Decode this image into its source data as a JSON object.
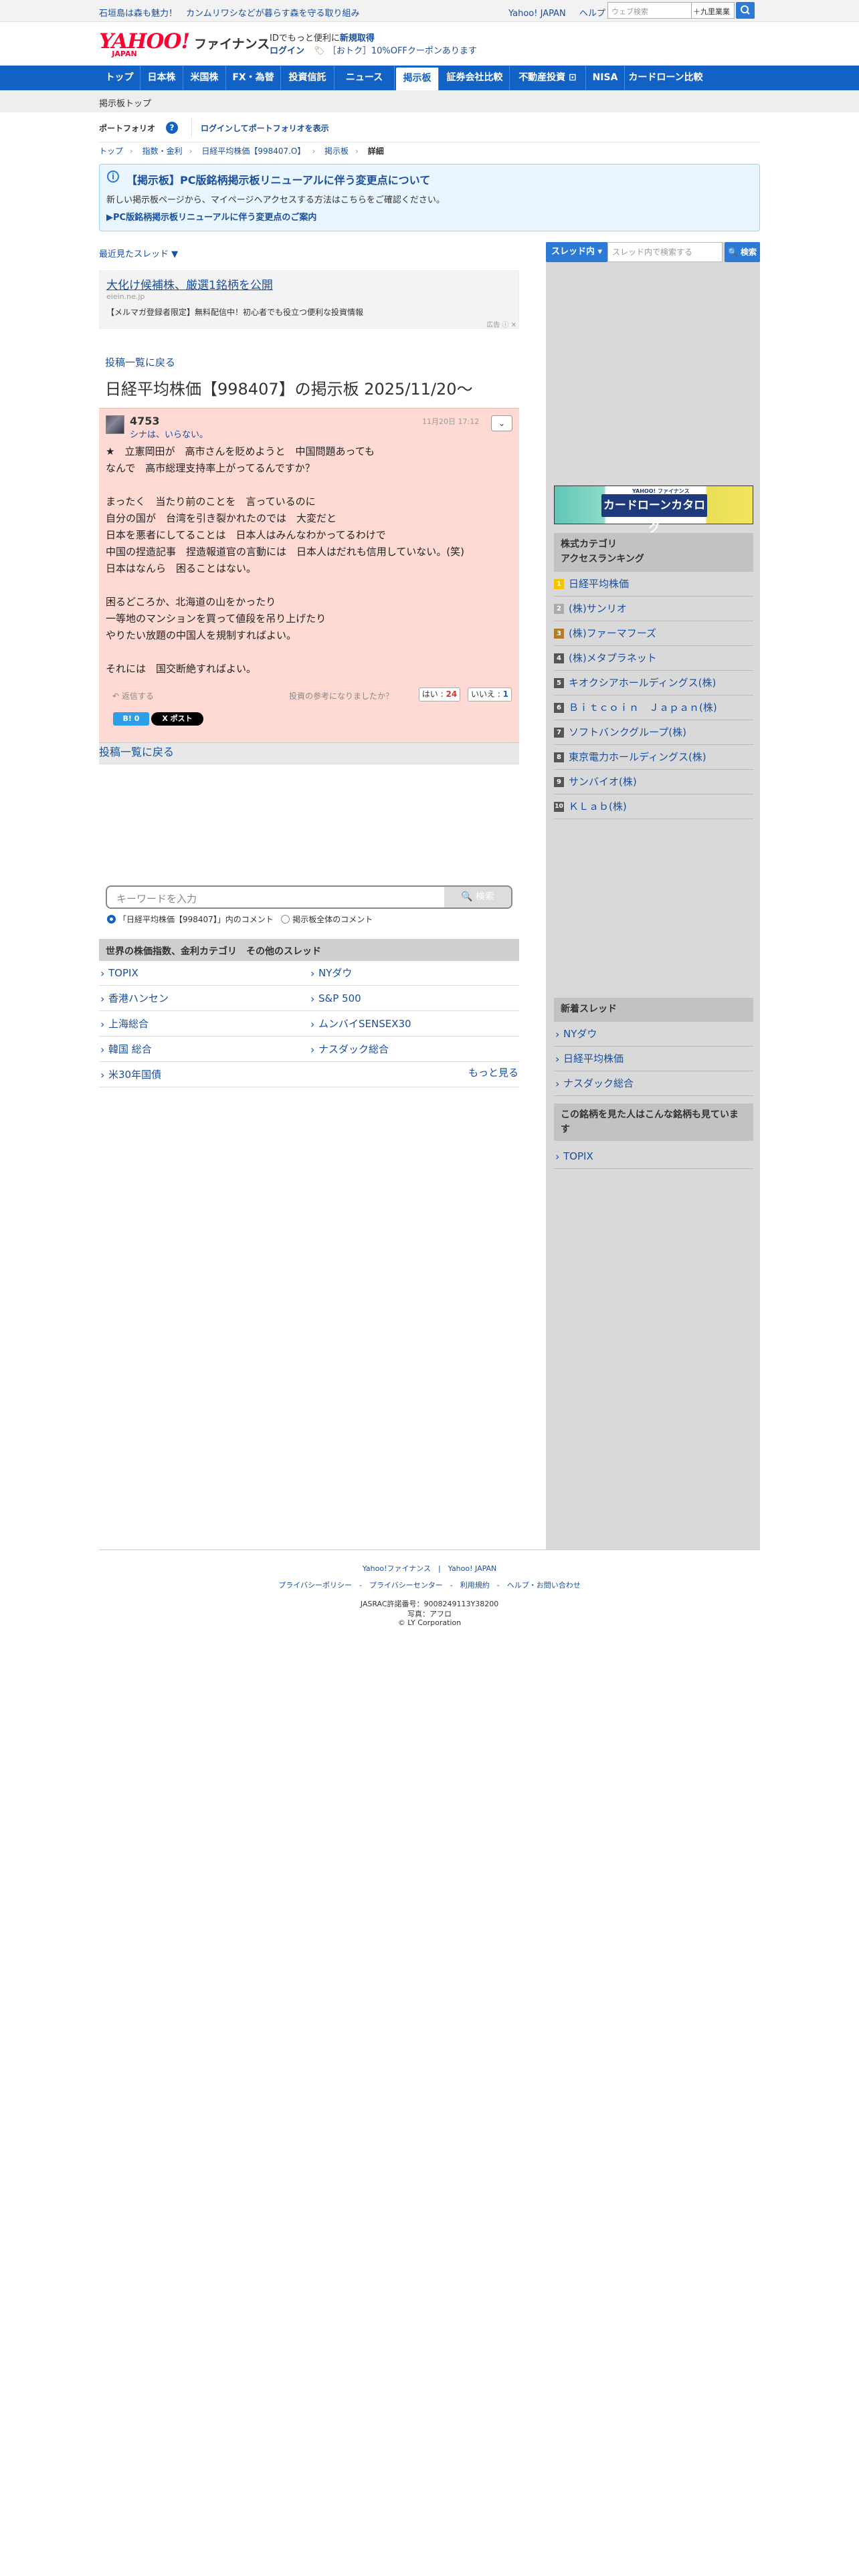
{
  "topbar": {
    "promo": "石垣島は森も魅力！　カンムリワシなどが暮らす森を守る取り組み",
    "links": [
      "Yahoo! JAPAN",
      "ヘルプ"
    ],
    "web_search_placeholder": "ウェブ検索",
    "kudamon_label": "＋九里業業"
  },
  "header": {
    "logo_y": "YAHOO!",
    "logo_j": "JAPAN",
    "logo_f": "ファイナンス",
    "line1_text": "IDでもっと便利に",
    "line1_link": "新規取得",
    "login": "ログイン",
    "coupon": "［おトク］10%OFFクーポンあります"
  },
  "nav": {
    "items": [
      "トップ",
      "日本株",
      "米国株",
      "FX・為替",
      "投資信託",
      "ニュース",
      "掲示板",
      "証券会社比較",
      "不動産投資 ⊡",
      "NISA",
      "カードローン比較"
    ],
    "active_index": 6
  },
  "subnav": {
    "label": "掲示板トップ"
  },
  "portfolio": {
    "title": "ポートフォリオ",
    "help": "?",
    "link": "ログインしてポートフォリオを表示"
  },
  "breadcrumb": [
    "トップ",
    "指数・金利",
    "日経平均株価【998407.O】",
    "掲示板",
    "詳細"
  ],
  "notice": {
    "icon": "i",
    "title": "【掲示板】PC版銘柄掲示板リニューアルに伴う変更点について",
    "desc": "新しい掲示板ページから、マイページへアクセスする方法はこちらをご確認ください。",
    "link": "▶PC版銘柄掲示板リニューアルに伴う変更点のご案内"
  },
  "recent_threads": "最近見たスレッド ▼",
  "ad": {
    "title": "大化け候補株、厳選1銘柄を公開",
    "domain": "eiein.ne.jp",
    "desc": "【メルマガ登録者限定】無料配信中！初心者でも役立つ便利な投資情報",
    "label": "広告 ⓘ ✕"
  },
  "board": {
    "back": "投稿一覧に戻る",
    "title": "日経平均株価【998407】の掲示板 2025/11/20〜"
  },
  "post": {
    "number": "4753",
    "author": "シナは、いらない。",
    "date": "11月20日 17:12",
    "menu": "⌄",
    "body": "★　立憲岡田が　高市さんを貶めようと　中国問題あっても\nなんで　高市総理支持率上がってるんですか？\n\nまったく　当たり前のことを　言っているのに\n自分の国が　台湾を引き裂かれたのでは　大変だと\n日本を悪者にしてることは　日本人はみんなわかってるわけで\n中国の捏造記事　捏造報道官の言動には　日本人はだれも信用していない。(笑)\n日本はなんら　困ることはない。\n\n困るどころか、北海道の山をかったり\n一等地のマンションを買って値段を吊り上げたり\nやりたい放題の中国人を規制すればよい。\n\nそれには　国交断絶すればよい。",
    "reply": "返信する",
    "helpful_q": "投資の参考になりましたか？",
    "yes_label": "はい",
    "yes_count": "24",
    "no_label": "いいえ",
    "no_count": "1",
    "share1": "B! 0",
    "share2": "X ポスト"
  },
  "back2": "投稿一覧に戻る",
  "search": {
    "placeholder": "キーワードを入力",
    "button": "🔍 検索",
    "radio1": "「日経平均株価【998407】」内のコメント",
    "radio2": "掲示板全体のコメント"
  },
  "other_threads": {
    "title": "世界の株価指数、金利カテゴリ　その他のスレッド",
    "items": [
      "TOPIX",
      "NYダウ",
      "香港ハンセン",
      "S&P 500",
      "上海総合",
      "ムンバイSENSEX30",
      "韓国 総合",
      "ナスダック総合",
      "米30年国債"
    ],
    "more": "もっと見る"
  },
  "sidebar": {
    "select": "スレッド内 ▾",
    "input_placeholder": "スレッド内で検索する",
    "search_btn": "🔍 検索",
    "banner_top": "YAHOO! ファイナンス",
    "banner": "カードローンカタログ",
    "ranking_title": "株式カテゴリ\nアクセスランキング",
    "ranking": [
      "日経平均株価",
      "(株)サンリオ",
      "(株)ファーマフーズ",
      "(株)メタプラネット",
      "キオクシアホールディングス(株)",
      "Ｂｉｔｃｏｉｎ　Ｊａｐａｎ(株)",
      "ソフトバンクグループ(株)",
      "東京電力ホールディングス(株)",
      "サンバイオ(株)",
      "ＫＬａｂ(株)"
    ],
    "rank_colors": [
      "#f5c400",
      "#aaaaaa",
      "#b07b2c",
      "#555555",
      "#555555",
      "#555555",
      "#555555",
      "#555555",
      "#555555",
      "#555555"
    ],
    "new_title": "新着スレッド",
    "new_items": [
      "NYダウ",
      "日経平均株価",
      "ナスダック総合"
    ],
    "also_title": "この銘柄を見た人はこんな銘柄も見ています",
    "also_items": [
      "TOPIX"
    ]
  },
  "footer": {
    "line1": "Yahoo!ファイナンス　|　Yahoo! JAPAN",
    "line2": "プライバシーポリシー　-　プライバシーセンター　-　利用規約　-　ヘルプ・お問い合わせ",
    "line3": "JASRAC許諾番号：9008249113Y38200",
    "line4": "写真：アフロ",
    "line5": "© LY Corporation"
  }
}
